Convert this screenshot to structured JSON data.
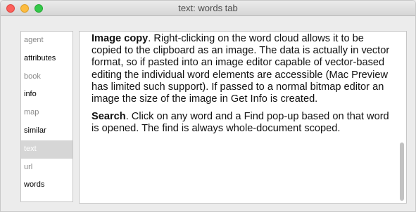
{
  "window": {
    "title": "text: words tab"
  },
  "sidebar": {
    "items": [
      {
        "label": "agent",
        "state": "dim"
      },
      {
        "label": "attributes",
        "state": "normal"
      },
      {
        "label": "book",
        "state": "dim"
      },
      {
        "label": "info",
        "state": "normal"
      },
      {
        "label": "map",
        "state": "dim"
      },
      {
        "label": "similar",
        "state": "normal"
      },
      {
        "label": "text",
        "state": "selected"
      },
      {
        "label": "url",
        "state": "dim"
      },
      {
        "label": "words",
        "state": "normal"
      }
    ]
  },
  "content": {
    "paragraphs": [
      {
        "heading": "Image copy",
        "body": ". Right-clicking on the word cloud allows it to be copied to the clipboard as an image. The data is actually in vector format, so if pasted into an image editor capable of vector-based editing the individual word elements are accessible (Mac Preview has limited such support). If passed to a normal bitmap editor an image the size of the image in Get Info is created."
      },
      {
        "heading": "Search",
        "body": ". Click on any word and a Find pop-up based on that word is opened. The find is always whole-document scoped."
      }
    ]
  },
  "colors": {
    "selected_tab_bg": "#d6d6d6",
    "dim_tab_text": "#8a8a8a",
    "close": "#fc605b",
    "minimize": "#fdbc40",
    "zoom": "#34c84a"
  }
}
